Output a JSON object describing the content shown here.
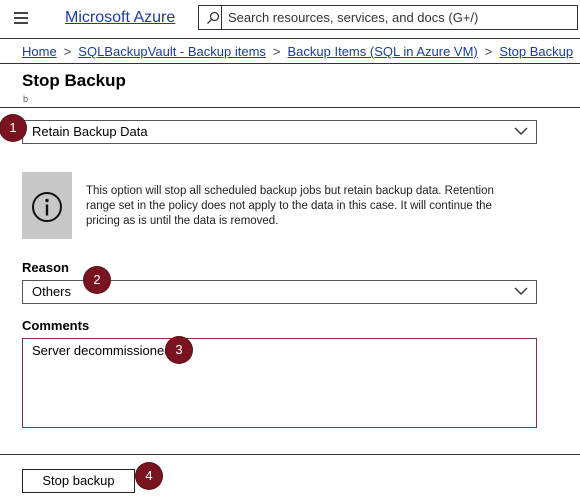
{
  "topbar": {
    "brand": "Microsoft Azure",
    "search_placeholder": "Search resources, services, and docs (G+/)"
  },
  "breadcrumb": [
    "Home",
    "SQLBackupVault - Backup items",
    "Backup Items (SQL in Azure VM)",
    "Stop Backup"
  ],
  "page": {
    "title": "Stop Backup",
    "subtitle": "b"
  },
  "form": {
    "backup_option": "Retain Backup Data",
    "info_text": "This option will stop all scheduled backup jobs but retain backup data. Retention range set in the policy does not apply to the data in this case. It will continue the pricing as is until the data is removed.",
    "reason_label": "Reason",
    "reason_value": "Others",
    "comments_label": "Comments",
    "comments_value": "Server decommissioned",
    "submit_label": "Stop backup"
  },
  "markers": [
    "1",
    "2",
    "3",
    "4"
  ]
}
